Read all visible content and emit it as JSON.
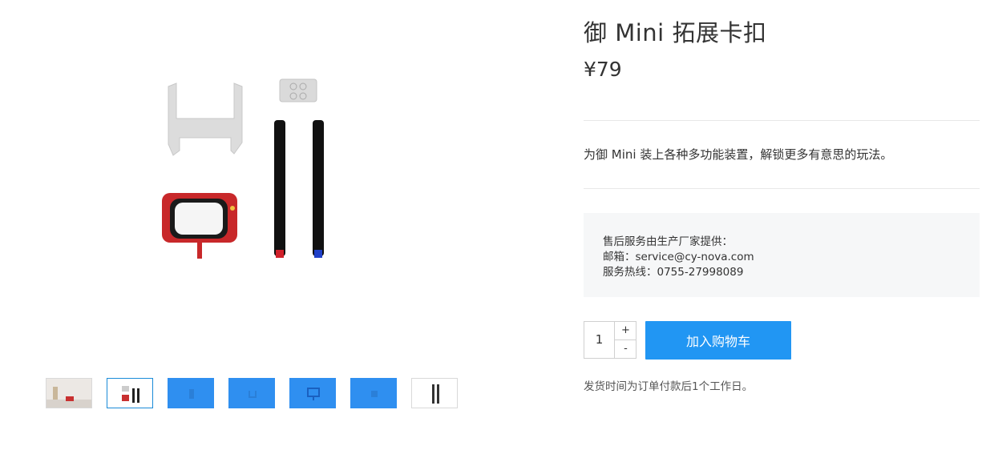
{
  "product": {
    "title": "御 Mini 拓展卡扣",
    "price": "¥79",
    "description": "为御 Mini 装上各种多功能装置，解锁更多有意思的玩法。"
  },
  "service": {
    "line1": "售后服务由生产厂家提供：",
    "line2": "邮箱：service@cy-nova.com",
    "line3": "服务热线：0755-27998089"
  },
  "purchase": {
    "quantity": "1",
    "plus_label": "+",
    "minus_label": "-",
    "add_to_cart_label": "加入购物车"
  },
  "shipping": {
    "note": "发货时间为订单付款后1个工作日。"
  },
  "colors": {
    "accent": "#2196f3",
    "thumb_blue": "#2f8ff0",
    "active_border": "#1a8bd8"
  }
}
